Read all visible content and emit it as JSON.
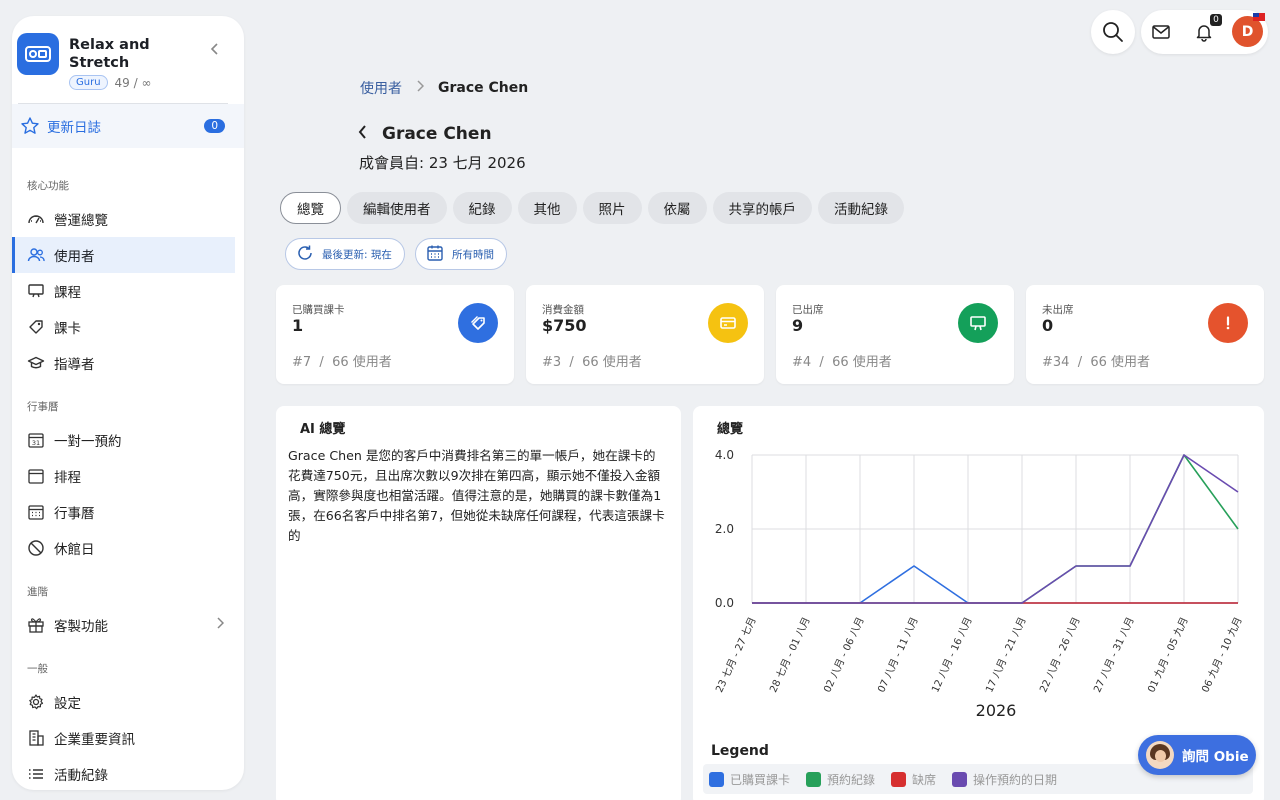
{
  "sidebar": {
    "app_title": "Relax and Stretch",
    "plan_badge": "Guru",
    "plan_count": "49 / ∞",
    "changelog": {
      "label": "更新日誌",
      "badge": "0"
    },
    "sections": [
      {
        "title": "核心功能",
        "items": [
          {
            "label": "營運總覽",
            "icon": "dashboard-icon"
          },
          {
            "label": "使用者",
            "icon": "users-icon",
            "active": true
          },
          {
            "label": "課程",
            "icon": "class-icon"
          },
          {
            "label": "課卡",
            "icon": "ticket-icon"
          },
          {
            "label": "指導者",
            "icon": "graduation-cap-icon"
          }
        ]
      },
      {
        "title": "行事曆",
        "items": [
          {
            "label": "一對一預約",
            "icon": "calendar-31-icon"
          },
          {
            "label": "排程",
            "icon": "calendar-icon"
          },
          {
            "label": "行事曆",
            "icon": "calendar-grid-icon"
          },
          {
            "label": "休館日",
            "icon": "ban-icon"
          }
        ]
      },
      {
        "title": "進階",
        "items": [
          {
            "label": "客製功能",
            "icon": "gift-icon",
            "chevron": true
          }
        ]
      },
      {
        "title": "一般",
        "items": [
          {
            "label": "設定",
            "icon": "gear-icon"
          },
          {
            "label": "企業重要資訊",
            "icon": "building-icon"
          },
          {
            "label": "活動紀錄",
            "icon": "list-icon"
          }
        ]
      }
    ]
  },
  "topbar": {
    "notification_count": "0",
    "avatar_initial": "D"
  },
  "header": {
    "breadcrumb_parent": "使用者",
    "breadcrumb_current": "Grace Chen",
    "title": "Grace Chen",
    "member_since": "成會員自: 23 七月 2026"
  },
  "tabs": [
    "總覽",
    "編輯使用者",
    "紀錄",
    "其他",
    "照片",
    "依屬",
    "共享的帳戶",
    "活動紀錄"
  ],
  "filters": {
    "last_updated": "最後更新: 現在",
    "time_range": "所有時間"
  },
  "stats": [
    {
      "label": "已購買課卡",
      "value": "1",
      "rank": "#7",
      "total": "66 使用者",
      "color": "#2f6fe0",
      "icon": "tag-icon"
    },
    {
      "label": "消費金額",
      "value": "$750",
      "rank": "#3",
      "total": "66 使用者",
      "color": "#f5c211",
      "icon": "credit-card-icon"
    },
    {
      "label": "已出席",
      "value": "9",
      "rank": "#4",
      "total": "66 使用者",
      "color": "#14a05a",
      "icon": "presentation-icon"
    },
    {
      "label": "未出席",
      "value": "0",
      "rank": "#34",
      "total": "66 使用者",
      "color": "#e5532d",
      "icon": "exclamation-icon"
    }
  ],
  "ai": {
    "title": "AI 總覽",
    "text": "Grace Chen 是您的客戶中消費排名第三的單一帳戶，她在課卡的花費達750元，且出席次數以9次排在第四高，顯示她不僅投入金額高，實際參與度也相當活躍。值得注意的是，她購買的課卡數僅為1張，在66名客戶中排名第7，但她從未缺席任何課程，代表這張課卡的"
  },
  "chart_data": {
    "type": "line",
    "title": "總覽",
    "xlabel": "2026",
    "ylabel": "",
    "ylim": [
      0,
      4
    ],
    "yticks": [
      "0.0",
      "2.0",
      "4.0"
    ],
    "categories": [
      "23 七月 - 27 七月",
      "28 七月 - 01 八月",
      "02 八月 - 06 八月",
      "07 八月 - 11 八月",
      "12 八月 - 16 八月",
      "17 八月 - 21 八月",
      "22 八月 - 26 八月",
      "27 八月 - 31 八月",
      "01 九月 - 05 九月",
      "06 九月 - 10 九月"
    ],
    "legend_title": "Legend",
    "series": [
      {
        "name": "已購買課卡",
        "color": "#2f6fe0",
        "values": [
          0,
          0,
          0,
          1,
          0,
          0,
          0,
          0,
          0,
          0
        ]
      },
      {
        "name": "預約紀錄",
        "color": "#27a05a",
        "values": [
          0,
          0,
          0,
          0,
          0,
          0,
          1,
          1,
          4,
          2
        ]
      },
      {
        "name": "缺席",
        "color": "#d62f2f",
        "values": [
          0,
          0,
          0,
          0,
          0,
          0,
          0,
          0,
          0,
          0
        ]
      },
      {
        "name": "操作預約的日期",
        "color": "#6a4bb0",
        "values": [
          0,
          0,
          0,
          0,
          0,
          0,
          1,
          1,
          4,
          3
        ]
      }
    ]
  },
  "obie": {
    "label": "詢問 Obie"
  }
}
